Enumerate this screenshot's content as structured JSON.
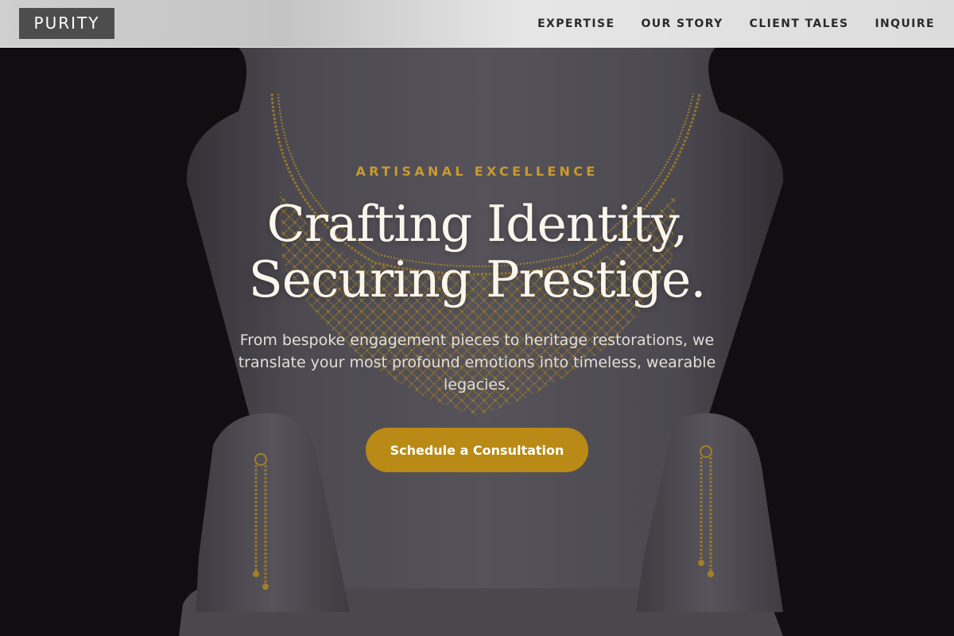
{
  "header": {
    "logo_text": "PURITY",
    "nav": [
      {
        "label": "EXPERTISE"
      },
      {
        "label": "OUR STORY"
      },
      {
        "label": "CLIENT TALES"
      },
      {
        "label": "INQUIRE"
      }
    ]
  },
  "hero": {
    "eyebrow": "ARTISANAL EXCELLENCE",
    "headline_line1": "Crafting Identity,",
    "headline_line2": "Securing Prestige.",
    "subtitle": "From bespoke engagement pieces to heritage restorations, we translate your most profound emotions into timeless, wearable legacies.",
    "cta_label": "Schedule a Consultation"
  },
  "colors": {
    "accent_gold": "#c99a2e",
    "cta_gold": "#b98a15",
    "background_dark": "#121112",
    "header_bg": "#d9d9d9",
    "logo_bg": "#4d4d4d"
  }
}
